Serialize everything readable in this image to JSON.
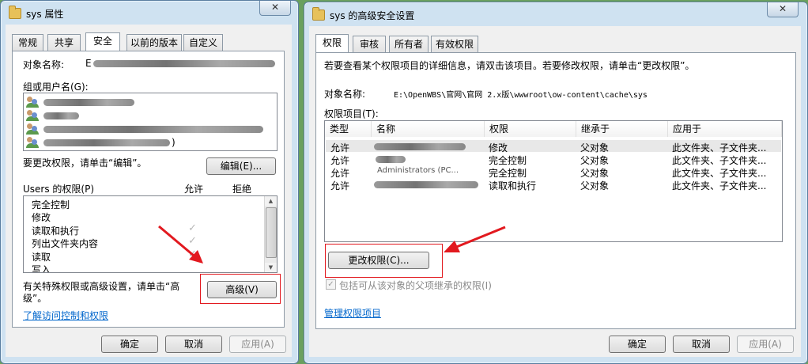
{
  "left_window": {
    "title": "sys 属性",
    "tabs": [
      "常规",
      "共享",
      "安全",
      "以前的版本",
      "自定义"
    ],
    "object_name_label": "对象名称:",
    "object_name_prefix": "E",
    "group_label": "组或用户名(G):",
    "users": [
      "",
      "",
      "",
      ")"
    ],
    "edit_hint": "要更改权限，请单击“编辑”。",
    "edit_button": "编辑(E)...",
    "perm_header": "Users 的权限(P)",
    "allow_col": "允许",
    "deny_col": "拒绝",
    "permissions": [
      "完全控制",
      "修改",
      "读取和执行",
      "列出文件夹内容",
      "读取",
      "写入"
    ],
    "advanced_hint_line1": "有关特殊权限或高级设置，请单击“高",
    "advanced_hint_line2": "级”。",
    "advanced_button": "高级(V)",
    "learn_link": "了解访问控制和权限",
    "ok_button": "确定",
    "cancel_button": "取消",
    "apply_button": "应用(A)"
  },
  "right_window": {
    "title": "sys 的高级安全设置",
    "tabs": [
      "权限",
      "审核",
      "所有者",
      "有效权限"
    ],
    "info_text": "若要查看某个权限项目的详细信息，请双击该项目。若要修改权限，请单击“更改权限”。",
    "object_name_label": "对象名称:",
    "object_path": "E:\\OpenWBS\\官网\\官网 2.x版\\wwwroot\\ow-content\\cache\\sys",
    "entries_label": "权限项目(T):",
    "columns": [
      "类型",
      "名称",
      "权限",
      "继承于",
      "应用于"
    ],
    "rows": [
      {
        "type": "允许",
        "name": "",
        "perm": "修改",
        "inherit": "父对象",
        "apply": "此文件夹、子文件夹..."
      },
      {
        "type": "允许",
        "name": "",
        "perm": "完全控制",
        "inherit": "父对象",
        "apply": "此文件夹、子文件夹..."
      },
      {
        "type": "允许",
        "name": "Administrators (PC...",
        "perm": "完全控制",
        "inherit": "父对象",
        "apply": "此文件夹、子文件夹..."
      },
      {
        "type": "允许",
        "name": "",
        "perm": "读取和执行",
        "inherit": "父对象",
        "apply": "此文件夹、子文件夹..."
      }
    ],
    "change_button": "更改权限(C)...",
    "inherit_checkbox": "包括可从该对象的父项继承的权限(I)",
    "manage_link": "管理权限项目",
    "ok_button": "确定",
    "cancel_button": "取消",
    "apply_button": "应用(A)"
  },
  "colors": {
    "annotation_red": "#e2191f",
    "link_blue": "#0066cc"
  }
}
